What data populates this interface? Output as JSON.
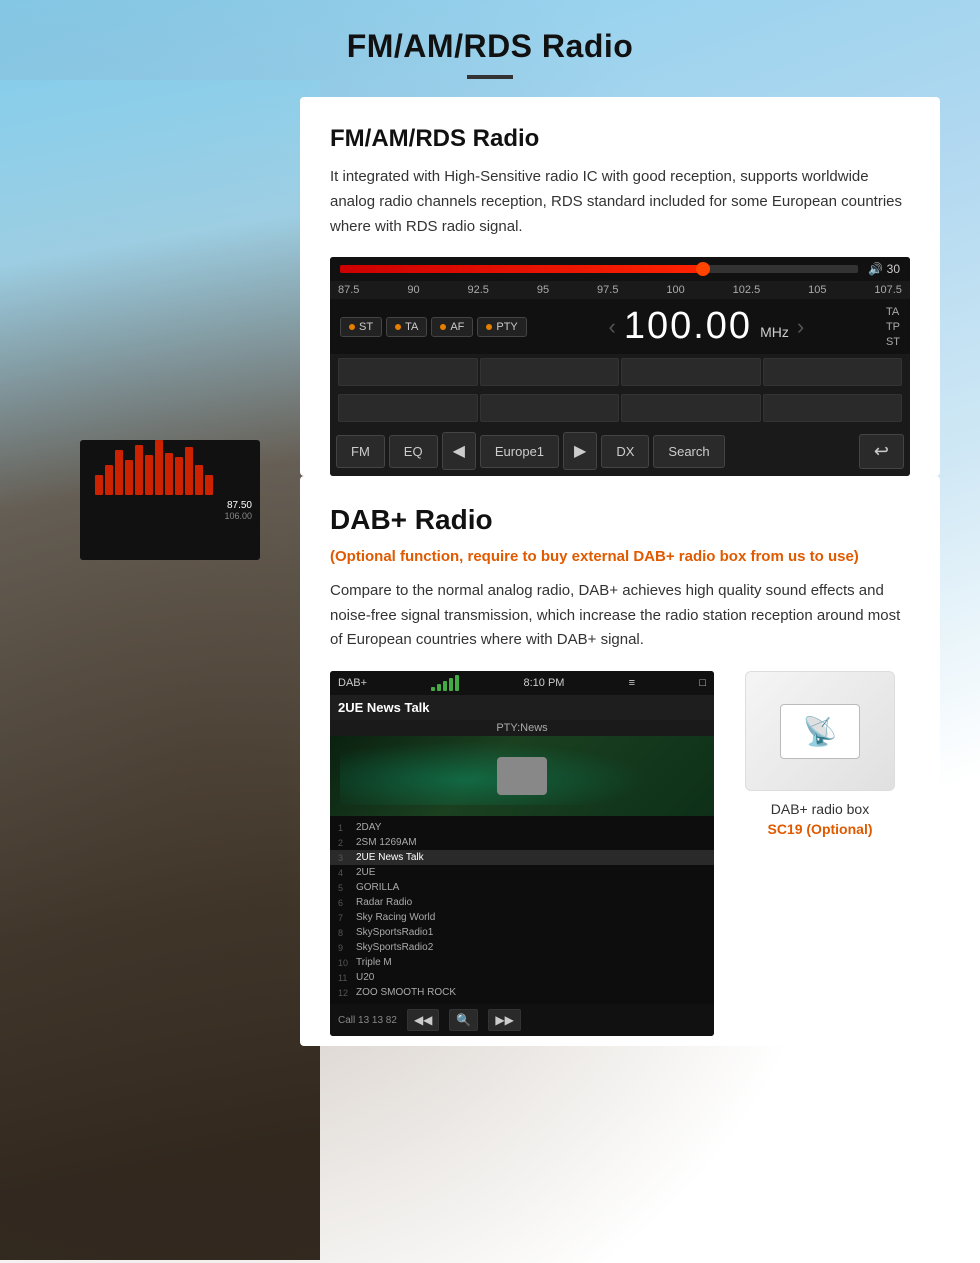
{
  "page": {
    "title": "FM/AM/RDS Radio",
    "title_divider": true
  },
  "fm_section": {
    "title": "FM/AM/RDS Radio",
    "description": "It integrated with High-Sensitive radio IC with good reception, supports worldwide analog radio channels reception, RDS standard included for some European countries where with RDS radio signal."
  },
  "radio_ui": {
    "volume": "30",
    "frequency": "100.00",
    "unit": "MHz",
    "scale_labels": [
      "87.5",
      "90",
      "92.5",
      "95",
      "97.5",
      "100",
      "102.5",
      "105",
      "107.5"
    ],
    "modes": [
      "ST",
      "TA",
      "AF",
      "PTY"
    ],
    "right_modes": [
      "TA",
      "TP",
      "ST"
    ],
    "progress_pct": 70,
    "bottom_buttons": [
      "FM",
      "EQ",
      "Europe1",
      "DX",
      "Search"
    ],
    "bottom_icons": [
      "prev",
      "next",
      "back"
    ]
  },
  "dab_section": {
    "title": "DAB+ Radio",
    "optional_text": "(Optional function, require to buy external DAB+ radio box from us to use)",
    "description": "Compare to the normal analog radio, DAB+ achieves high quality sound effects and noise-free signal transmission, which increase the radio station reception around most of European countries where with DAB+ signal.",
    "dab_box_label": "DAB+ radio box",
    "dab_box_model": "SC19 (Optional)"
  },
  "dab_ui": {
    "label": "DAB+",
    "time": "8:10 PM",
    "channel": "2UE News Talk",
    "pty": "PTY:News",
    "call_text": "Call 13 13 82",
    "station_list": [
      {
        "num": "1",
        "name": "2DAY"
      },
      {
        "num": "2",
        "name": "2SM 1269AM"
      },
      {
        "num": "3",
        "name": "2UE News Talk"
      },
      {
        "num": "4",
        "name": "2UE"
      },
      {
        "num": "5",
        "name": "GORILLA"
      },
      {
        "num": "6",
        "name": "Radar Radio"
      },
      {
        "num": "7",
        "name": "Sky Racing World"
      },
      {
        "num": "8",
        "name": "SkySportsRadio1"
      },
      {
        "num": "9",
        "name": "SkySportsRadio2"
      },
      {
        "num": "10",
        "name": "Triple M"
      },
      {
        "num": "11",
        "name": "U20"
      },
      {
        "num": "12",
        "name": "ZOO SMOOTH ROCK"
      }
    ]
  },
  "colors": {
    "accent_orange": "#e05a00",
    "radio_red": "#cc0000",
    "dark_bg": "#1a1a1a",
    "title_dark": "#111111"
  }
}
